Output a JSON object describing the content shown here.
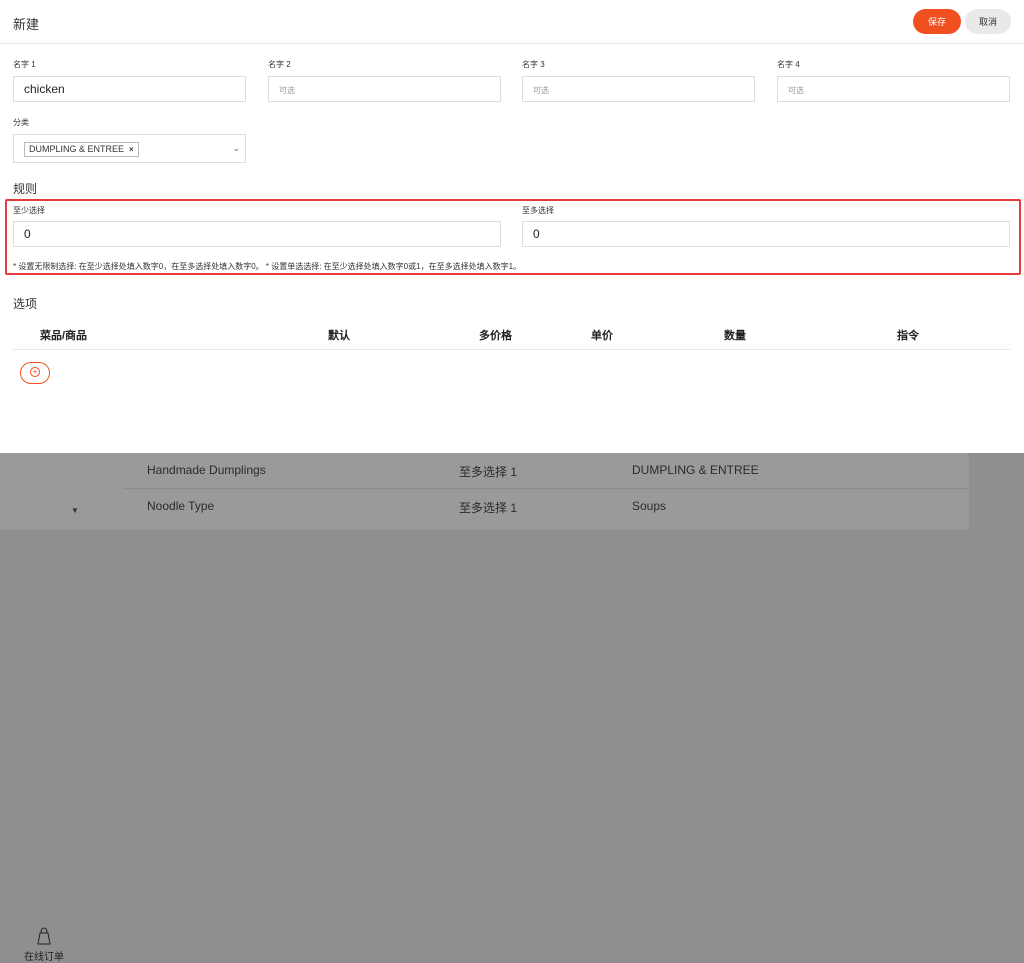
{
  "modal": {
    "title": "新建",
    "save_label": "保存",
    "cancel_label": "取消",
    "names": [
      {
        "label": "名字 1",
        "value": "chicken",
        "placeholder": ""
      },
      {
        "label": "名字 2",
        "value": "",
        "placeholder": "可选"
      },
      {
        "label": "名字 3",
        "value": "",
        "placeholder": "可选"
      },
      {
        "label": "名字 4",
        "value": "",
        "placeholder": "可选"
      }
    ],
    "category_label": "分类",
    "category_chip": "DUMPLING & ENTREE",
    "chip_remove": "×",
    "rules_title": "规则",
    "min_label": "至少选择",
    "min_value": "0",
    "max_label": "至多选择",
    "max_value": "0",
    "hint": "* 设置无限制选择: 在至少选择处填入数字0，在至多选择处填入数字0。 * 设置单选选择: 在至少选择处填入数字0或1，在至多选择处填入数字1。",
    "options_title": "选项",
    "columns": [
      "菜品/商品",
      "默认",
      "多价格",
      "单价",
      "数量",
      "指令"
    ],
    "add_symbol": "+"
  },
  "background": {
    "rows": [
      {
        "name": "Handmade Dumplings",
        "rule": "至多选择 1",
        "category": "DUMPLING & ENTREE"
      },
      {
        "name": "Noodle Type",
        "rule": "至多选择 1",
        "category": "Soups"
      }
    ],
    "nav_label": "在线订单",
    "nav_caret": "▼"
  },
  "colors": {
    "accent": "#f04f1f",
    "highlight": "#e8393b"
  }
}
